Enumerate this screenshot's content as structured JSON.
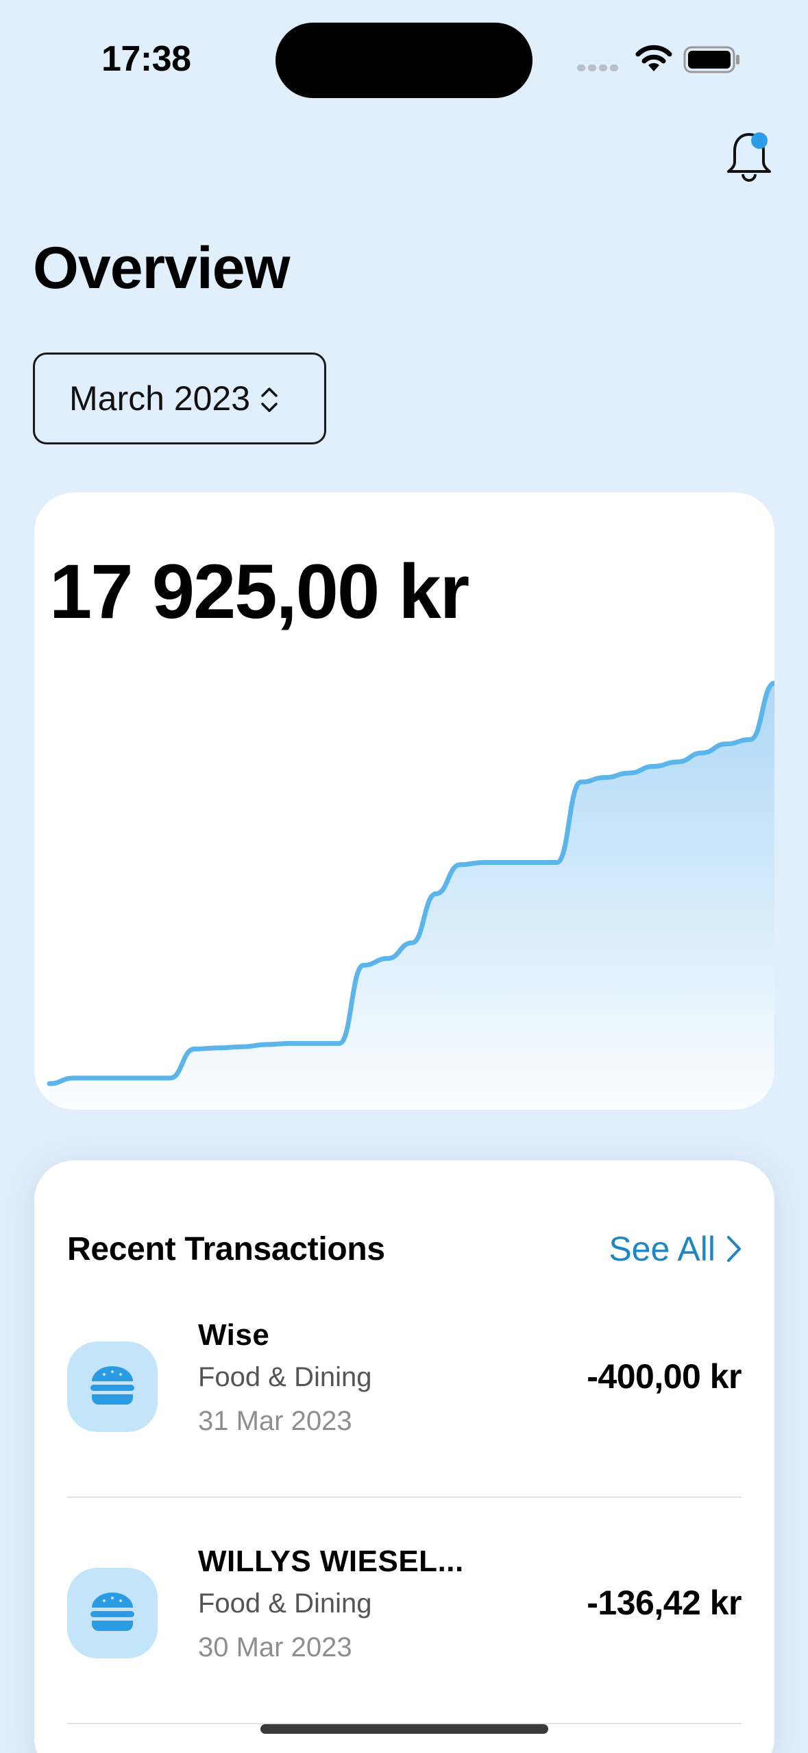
{
  "status_bar": {
    "time": "17:38"
  },
  "header": {
    "title": "Overview",
    "bell_icon": "bell-icon",
    "has_notification": true
  },
  "month_picker": {
    "label": "March 2023",
    "icon": "chevron-up-down-icon"
  },
  "balance_card": {
    "amount": "17 925,00 kr",
    "line_color": "#5bb5ea",
    "fill_color": "#a9d6f5"
  },
  "chart_data": {
    "type": "area",
    "title": "",
    "x": [
      1,
      2,
      3,
      4,
      5,
      6,
      7,
      8,
      9,
      10,
      11,
      12,
      13,
      14,
      15,
      16,
      17,
      18,
      19,
      20,
      21,
      22,
      23,
      24,
      25,
      26,
      27,
      28,
      29,
      30,
      31
    ],
    "series": [
      {
        "values": [
          0,
          250,
          250,
          250,
          250,
          250,
          1550,
          1600,
          1650,
          1750,
          1800,
          1800,
          1800,
          5300,
          5600,
          6300,
          8500,
          9800,
          9900,
          9900,
          9900,
          9900,
          13500,
          13700,
          13900,
          14200,
          14400,
          14800,
          15200,
          15400,
          17925
        ]
      }
    ],
    "ylim": [
      0,
      17925
    ],
    "grid": false
  },
  "transactions": {
    "title": "Recent Transactions",
    "see_all": "See All",
    "items": [
      {
        "name": "Wise",
        "category": "Food & Dining",
        "date": "31 Mar 2023",
        "amount": "-400,00 kr",
        "icon": "burger-icon"
      },
      {
        "name": "WILLYS WIESEL...",
        "category": "Food & Dining",
        "date": "30 Mar 2023",
        "amount": "-136,42 kr",
        "icon": "burger-icon"
      }
    ]
  }
}
